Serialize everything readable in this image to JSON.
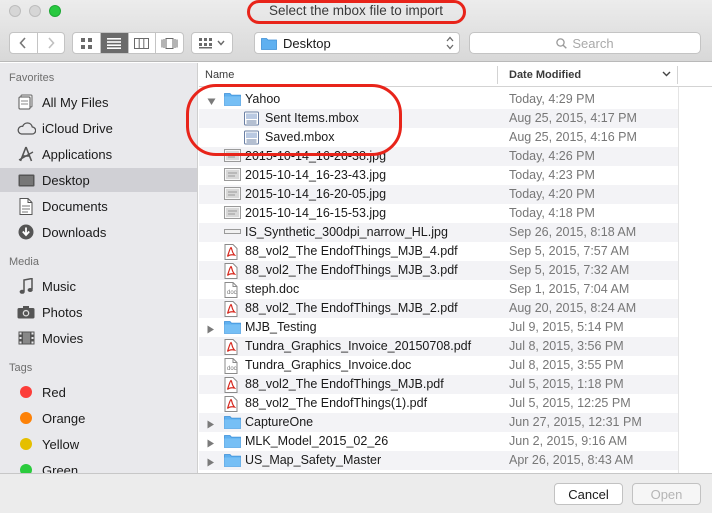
{
  "window": {
    "title": "Select the mbox file to import"
  },
  "toolbar": {
    "location": "Desktop",
    "search_placeholder": "Search"
  },
  "sidebar": {
    "favorites_heading": "Favorites",
    "favorites": [
      {
        "label": "All My Files",
        "icon": "all-files-icon"
      },
      {
        "label": "iCloud Drive",
        "icon": "cloud-icon"
      },
      {
        "label": "Applications",
        "icon": "applications-icon"
      },
      {
        "label": "Desktop",
        "icon": "desktop-icon",
        "selected": true
      },
      {
        "label": "Documents",
        "icon": "documents-icon"
      },
      {
        "label": "Downloads",
        "icon": "downloads-icon"
      }
    ],
    "media_heading": "Media",
    "media": [
      {
        "label": "Music",
        "icon": "music-icon"
      },
      {
        "label": "Photos",
        "icon": "camera-icon"
      },
      {
        "label": "Movies",
        "icon": "film-icon"
      }
    ],
    "tags_heading": "Tags",
    "tags": [
      {
        "label": "Red",
        "color": "#fc3d39"
      },
      {
        "label": "Orange",
        "color": "#fd8208"
      },
      {
        "label": "Yellow",
        "color": "#e5bf00"
      },
      {
        "label": "Green",
        "color": "#2bcb3d"
      }
    ]
  },
  "columns": {
    "name": "Name",
    "date_modified": "Date Modified"
  },
  "files": [
    {
      "name": "Yahoo",
      "date": "Today, 4:29 PM",
      "kind": "folder",
      "disclosure": "open",
      "level": 0
    },
    {
      "name": "Sent Items.mbox",
      "date": "Aug 25, 2015, 4:17 PM",
      "kind": "mbox",
      "level": 1
    },
    {
      "name": "Saved.mbox",
      "date": "Aug 25, 2015, 4:16 PM",
      "kind": "mbox",
      "level": 1
    },
    {
      "name": "2015-10-14_16-26-38.jpg",
      "date": "Today, 4:26 PM",
      "kind": "image",
      "level": 0
    },
    {
      "name": "2015-10-14_16-23-43.jpg",
      "date": "Today, 4:23 PM",
      "kind": "image",
      "level": 0
    },
    {
      "name": "2015-10-14_16-20-05.jpg",
      "date": "Today, 4:20 PM",
      "kind": "image",
      "level": 0
    },
    {
      "name": "2015-10-14_16-15-53.jpg",
      "date": "Today, 4:18 PM",
      "kind": "image",
      "level": 0
    },
    {
      "name": "IS_Synthetic_300dpi_narrow_HL.jpg",
      "date": "Sep 26, 2015, 8:18 AM",
      "kind": "image-thin",
      "level": 0
    },
    {
      "name": "88_vol2_The EndofThings_MJB_4.pdf",
      "date": "Sep 5, 2015, 7:57 AM",
      "kind": "pdf",
      "level": 0
    },
    {
      "name": "88_vol2_The EndofThings_MJB_3.pdf",
      "date": "Sep 5, 2015, 7:32 AM",
      "kind": "pdf",
      "level": 0
    },
    {
      "name": "steph.doc",
      "date": "Sep 1, 2015, 7:04 AM",
      "kind": "doc",
      "level": 0
    },
    {
      "name": "88_vol2_The EndofThings_MJB_2.pdf",
      "date": "Aug 20, 2015, 8:24 AM",
      "kind": "pdf",
      "level": 0
    },
    {
      "name": "MJB_Testing",
      "date": "Jul 9, 2015, 5:14 PM",
      "kind": "folder",
      "disclosure": "closed",
      "level": 0
    },
    {
      "name": "Tundra_Graphics_Invoice_20150708.pdf",
      "date": "Jul 8, 2015, 3:56 PM",
      "kind": "pdf",
      "level": 0
    },
    {
      "name": "Tundra_Graphics_Invoice.doc",
      "date": "Jul 8, 2015, 3:55 PM",
      "kind": "doc",
      "level": 0
    },
    {
      "name": "88_vol2_The EndofThings_MJB.pdf",
      "date": "Jul 5, 2015, 1:18 PM",
      "kind": "pdf",
      "level": 0
    },
    {
      "name": "88_vol2_The EndofThings(1).pdf",
      "date": "Jul 5, 2015, 12:25 PM",
      "kind": "pdf",
      "level": 0
    },
    {
      "name": "CaptureOne",
      "date": "Jun 27, 2015, 12:31 PM",
      "kind": "folder",
      "disclosure": "closed",
      "level": 0
    },
    {
      "name": "MLK_Model_2015_02_26",
      "date": "Jun 2, 2015, 9:16 AM",
      "kind": "folder",
      "disclosure": "closed",
      "level": 0
    },
    {
      "name": "US_Map_Safety_Master",
      "date": "Apr 26, 2015, 8:43 AM",
      "kind": "folder",
      "disclosure": "closed",
      "level": 0
    }
  ],
  "buttons": {
    "cancel": "Cancel",
    "open": "Open"
  },
  "colors": {
    "folder": "#5fb0f0",
    "pdf_red": "#d6281e",
    "annotation": "#e8241a",
    "selected_sidebar": "#d0d0d5"
  }
}
